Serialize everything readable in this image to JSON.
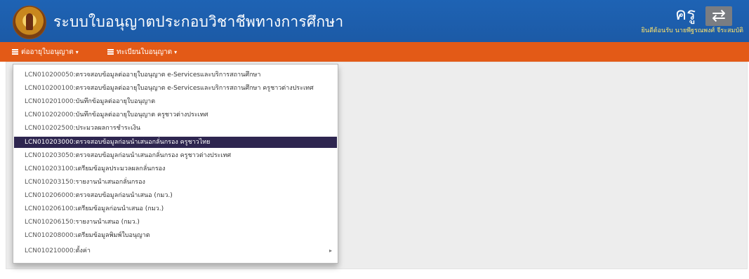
{
  "header": {
    "title": "ระบบใบอนุญาตประกอบวิชาชีพทางการศึกษา",
    "role": "ครู",
    "user_info": "ยินดีต้อนรับ นายพีฐรณพงศ์ จีระสมบัติ",
    "switch_icon": "⇄"
  },
  "nav": {
    "item1": "ต่ออายุใบอนุญาต",
    "item2": "ทะเบียนใบอนุญาต"
  },
  "menu": {
    "items": [
      {
        "code": "LCN010200050",
        "desc": ":ตรวจสอบข้อมูลต่ออายุใบอนุญาต e-Servicesและบริการสถานศึกษา"
      },
      {
        "code": "LCN010200100",
        "desc": ":ตรวจสอบข้อมูลต่ออายุใบอนุญาต e-Servicesและบริการสถานศึกษา ครูชาวต่างประเทศ"
      },
      {
        "code": "LCN010201000",
        "desc": ":บันทึกข้อมูลต่ออายุใบอนุญาต"
      },
      {
        "code": "LCN010202000",
        "desc": ":บันทึกข้อมูลต่ออายุใบอนุญาต ครูชาวต่างประเทศ"
      },
      {
        "code": "LCN010202500",
        "desc": ":ประมวลผลการชำระเงิน"
      },
      {
        "code": "LCN010203000",
        "desc": ":ตรวจสอบข้อมูลก่อนนำเสนอกลั่นกรอง ครูชาวไทย"
      },
      {
        "code": "LCN010203050",
        "desc": ":ตรวจสอบข้อมูลก่อนนำเสนอกลั่นกรอง ครูชาวต่างประเทศ"
      },
      {
        "code": "LCN010203100",
        "desc": ":เตรียมข้อมูลประมวลผลกลั่นกรอง"
      },
      {
        "code": "LCN010203150",
        "desc": ":รายงานนำเสนอกลั่นกรอง"
      },
      {
        "code": "LCN010206000",
        "desc": ":ตรวจสอบข้อมูลก่อนนำเสนอ (กมว.)"
      },
      {
        "code": "LCN010206100",
        "desc": ":เตรียมข้อมูลก่อนนำเสนอ (กมว.)"
      },
      {
        "code": "LCN010206150",
        "desc": ":รายงานนำเสนอ (กมว.)"
      },
      {
        "code": "LCN010208000",
        "desc": ":เตรียมข้อมูลพิมพ์ใบอนุญาต"
      },
      {
        "code": "LCN010210000",
        "desc": ":ตั้งค่า"
      }
    ],
    "active_index": 5,
    "submenu_arrow": "▸"
  },
  "colors": {
    "header_blue": "#1e63b4",
    "nav_orange": "#e35a17",
    "active_menu": "#2e2650"
  }
}
